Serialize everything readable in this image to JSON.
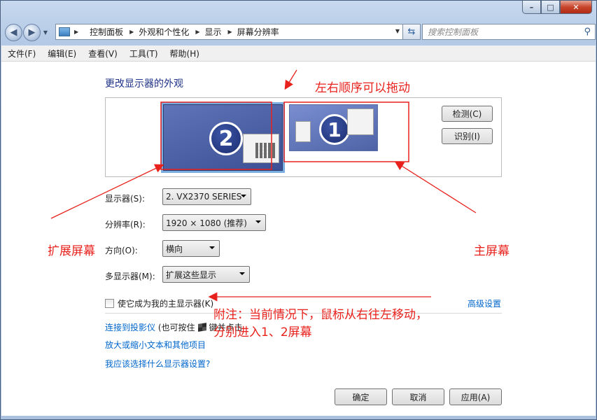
{
  "titlebar": {
    "minimize": "–",
    "maximize": "□",
    "close": "✕"
  },
  "nav": {
    "back_icon": "back-arrow-icon",
    "forward_icon": "forward-arrow-icon",
    "breadcrumbs": [
      "控制面板",
      "外观和个性化",
      "显示",
      "屏幕分辨率"
    ],
    "search_placeholder": "搜索控制面板"
  },
  "menu": [
    "文件(F)",
    "编辑(E)",
    "查看(V)",
    "工具(T)",
    "帮助(H)"
  ],
  "main": {
    "heading": "更改显示器的外观",
    "monitors": [
      {
        "number": "2",
        "selected": true
      },
      {
        "number": "1",
        "selected": false
      }
    ],
    "detect_button": "检测(C)",
    "identify_button": "识别(I)",
    "fields": {
      "display_label": "显示器(S):",
      "display_value": "2. VX2370 SERIES",
      "resolution_label": "分辨率(R):",
      "resolution_value": "1920 × 1080 (推荐)",
      "orientation_label": "方向(O):",
      "orientation_value": "横向",
      "multi_label": "多显示器(M):",
      "multi_value": "扩展这些显示"
    },
    "main_display_checkbox": "使它成为我的主显示器(K)",
    "main_display_checked": false,
    "advanced_link": "高级设置",
    "projector_link": "连接到投影仪",
    "projector_hint": "(也可按住",
    "projector_hint_tail": "键并点击",
    "text_size_link": "放大或缩小文本和其他项目",
    "help_link": "我应该选择什么显示器设置?"
  },
  "buttons": {
    "ok": "确定",
    "cancel": "取消",
    "apply": "应用(A)"
  },
  "annotations": {
    "drag_order": "左右顺序可以拖动",
    "extended_screen": "扩展屏幕",
    "main_screen": "主屏幕",
    "note_line1": "附注：当前情况下，鼠标从右往左移动，",
    "note_line2": "分别进入1、2屏幕",
    "color": "#e8211c"
  }
}
